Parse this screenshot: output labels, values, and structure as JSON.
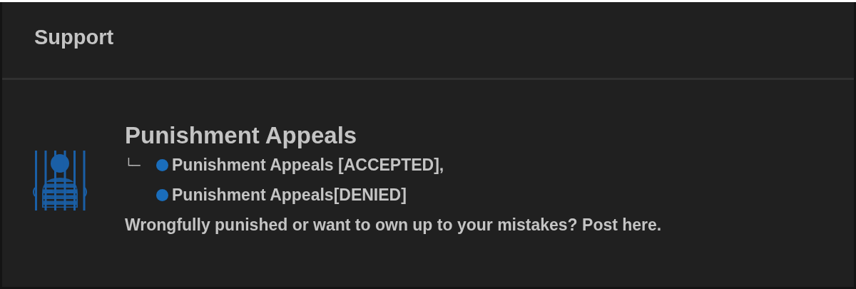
{
  "category": {
    "title": "Support"
  },
  "forums": [
    {
      "title": "Punishment Appeals",
      "branch": "└─",
      "subforums": [
        {
          "label": "Punishment Appeals [ACCEPTED],"
        },
        {
          "label": "Punishment Appeals[DENIED]"
        }
      ],
      "description": "Wrongfully punished or want to own up to your mistakes? Post here."
    }
  ]
}
